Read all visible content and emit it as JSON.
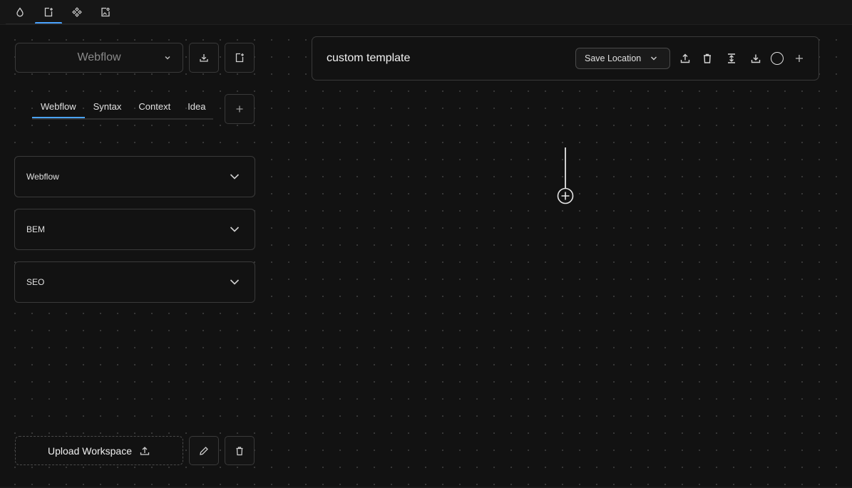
{
  "topbar": {
    "tabs": [
      {
        "icon": "drop-icon",
        "active": false
      },
      {
        "icon": "new-file-icon",
        "active": true
      },
      {
        "icon": "components-icon",
        "active": false
      },
      {
        "icon": "image-file-icon",
        "active": false
      }
    ]
  },
  "sidebar": {
    "workspace_select": {
      "value": "Webflow"
    },
    "tabs": [
      {
        "label": "Webflow",
        "active": true
      },
      {
        "label": "Syntax",
        "active": false
      },
      {
        "label": "Context",
        "active": false
      },
      {
        "label": "Idea",
        "active": false
      }
    ],
    "accordions": [
      {
        "label": "Webflow"
      },
      {
        "label": "BEM"
      },
      {
        "label": "SEO"
      }
    ],
    "upload_label": "Upload Workspace"
  },
  "editor": {
    "title": "custom template",
    "save_location_label": "Save Location"
  },
  "colors": {
    "accent": "#4aa3ff",
    "background": "#121212",
    "border": "#3a3a3a"
  }
}
